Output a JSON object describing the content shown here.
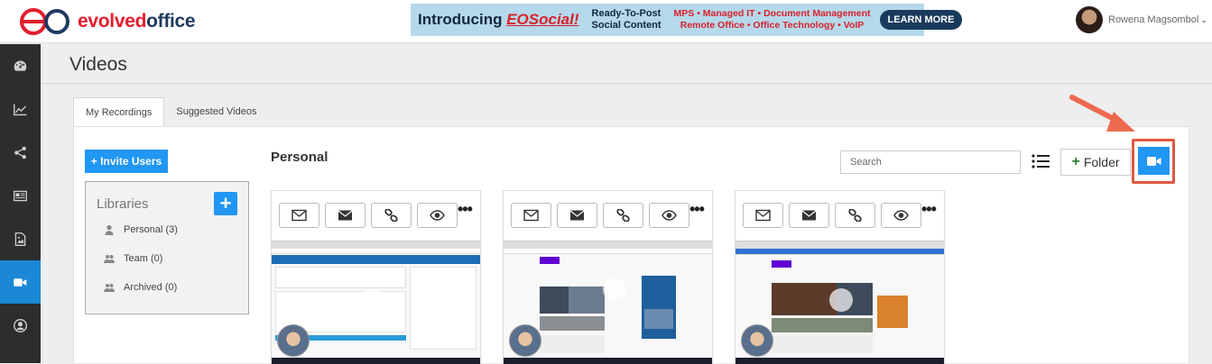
{
  "header": {
    "logo_text_a": "evolved",
    "logo_text_b": "office",
    "banner": {
      "title_prefix": "Introducing ",
      "title_emph": "EOSocial!",
      "sub_line1": "Ready-To-Post",
      "sub_line2": "Social Content",
      "services_line1": "MPS • Managed IT • Document Management",
      "services_line2": "Remote Office • Office Technology • VoIP",
      "cta": "LEARN MORE"
    },
    "user_name": "Rowena Magsombol",
    "user_caret": "⌄"
  },
  "sidebar": {
    "items": [
      {
        "icon": "dashboard-icon"
      },
      {
        "icon": "line-chart-icon"
      },
      {
        "icon": "share-icon"
      },
      {
        "icon": "news-icon"
      },
      {
        "icon": "image-icon"
      },
      {
        "icon": "video-camera-icon",
        "active": true
      },
      {
        "icon": "user-circle-icon"
      }
    ]
  },
  "page": {
    "title": "Videos",
    "tabs": [
      {
        "label": "My Recordings",
        "active": true
      },
      {
        "label": "Suggested Videos",
        "active": false
      }
    ]
  },
  "libraries": {
    "invite_label": "Invite Users",
    "invite_plus": "+",
    "title": "Libraries",
    "add_label": "+",
    "items": [
      {
        "label": "Personal (3)",
        "icon": "user-icon"
      },
      {
        "label": "Team (0)",
        "icon": "users-icon"
      },
      {
        "label": "Archived (0)",
        "icon": "users-icon"
      }
    ]
  },
  "content": {
    "section_title": "Personal",
    "search_placeholder": "Search",
    "folder_plus": "+",
    "folder_label": "Folder"
  },
  "cards": [
    {
      "more": "•••",
      "thumb": "crm"
    },
    {
      "more": "•••",
      "thumb": "yahoo"
    },
    {
      "more": "•••",
      "thumb": "yahoo2"
    }
  ],
  "colors": {
    "accent": "#2196f3",
    "sidebar": "#2d2d2d",
    "highlight": "#e0593f",
    "brand_red": "#e31e2d",
    "brand_navy": "#1f3a5f"
  }
}
